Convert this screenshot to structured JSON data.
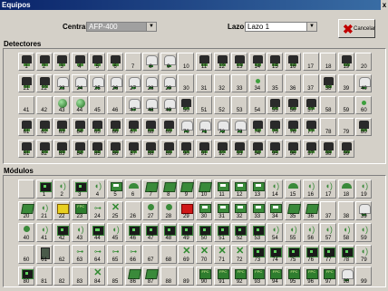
{
  "window": {
    "title": "Equipos",
    "close_glyph": "x"
  },
  "central": {
    "label": "Central",
    "value": "AFP-400"
  },
  "lazo": {
    "label": "Lazo",
    "value": "Lazo 1"
  },
  "cancel_label": "Cancelar",
  "detectores": {
    "title": "Detectores",
    "cells": [
      {
        "n": "1",
        "i": "detector"
      },
      {
        "n": "2",
        "i": "detector"
      },
      {
        "n": "3",
        "i": "detector"
      },
      {
        "n": "4",
        "i": "detector"
      },
      {
        "n": "5",
        "i": "detector"
      },
      {
        "n": "6",
        "i": "detector"
      },
      {
        "n": "7",
        "i": ""
      },
      {
        "n": "8",
        "i": "flat"
      },
      {
        "n": "9",
        "i": "flat"
      },
      {
        "n": "10",
        "i": ""
      },
      {
        "n": "11",
        "i": "detector"
      },
      {
        "n": "12",
        "i": "detector"
      },
      {
        "n": "13",
        "i": "detector"
      },
      {
        "n": "14",
        "i": "detector"
      },
      {
        "n": "15",
        "i": "detector"
      },
      {
        "n": "16",
        "i": "detector"
      },
      {
        "n": "17",
        "i": ""
      },
      {
        "n": "18",
        "i": ""
      },
      {
        "n": "19",
        "i": "detector"
      },
      {
        "n": "20",
        "i": ""
      },
      {
        "n": "21",
        "i": "detector"
      },
      {
        "n": "22",
        "i": "detector"
      },
      {
        "n": "23",
        "i": "flat"
      },
      {
        "n": "24",
        "i": "flat"
      },
      {
        "n": "25",
        "i": "flat"
      },
      {
        "n": "26",
        "i": "flat"
      },
      {
        "n": "27",
        "i": "flat"
      },
      {
        "n": "28",
        "i": "flat"
      },
      {
        "n": "29",
        "i": "flat"
      },
      {
        "n": "30",
        "i": ""
      },
      {
        "n": "31",
        "i": ""
      },
      {
        "n": "32",
        "i": ""
      },
      {
        "n": "33",
        "i": ""
      },
      {
        "n": "34",
        "i": "dot"
      },
      {
        "n": "35",
        "i": ""
      },
      {
        "n": "36",
        "i": ""
      },
      {
        "n": "37",
        "i": ""
      },
      {
        "n": "38",
        "i": "detector"
      },
      {
        "n": "39",
        "i": ""
      },
      {
        "n": "40",
        "i": "flat"
      },
      {
        "n": "41",
        "i": ""
      },
      {
        "n": "42",
        "i": ""
      },
      {
        "n": "43",
        "i": "ball"
      },
      {
        "n": "44",
        "i": "ball"
      },
      {
        "n": "45",
        "i": ""
      },
      {
        "n": "46",
        "i": ""
      },
      {
        "n": "47",
        "i": "flat"
      },
      {
        "n": "48",
        "i": "flat"
      },
      {
        "n": "49",
        "i": "flat"
      },
      {
        "n": "50",
        "i": "detector"
      },
      {
        "n": "51",
        "i": ""
      },
      {
        "n": "52",
        "i": ""
      },
      {
        "n": "53",
        "i": ""
      },
      {
        "n": "54",
        "i": ""
      },
      {
        "n": "55",
        "i": "detector"
      },
      {
        "n": "56",
        "i": "detector"
      },
      {
        "n": "57",
        "i": "detector"
      },
      {
        "n": "58",
        "i": ""
      },
      {
        "n": "59",
        "i": ""
      },
      {
        "n": "60",
        "i": "dot"
      },
      {
        "n": "61",
        "i": "detector"
      },
      {
        "n": "62",
        "i": "detector"
      },
      {
        "n": "63",
        "i": "detector"
      },
      {
        "n": "64",
        "i": "detector"
      },
      {
        "n": "65",
        "i": "detector"
      },
      {
        "n": "66",
        "i": "detector"
      },
      {
        "n": "67",
        "i": "detector"
      },
      {
        "n": "68",
        "i": "detector"
      },
      {
        "n": "69",
        "i": "detector"
      },
      {
        "n": "70",
        "i": "flat"
      },
      {
        "n": "71",
        "i": "flat"
      },
      {
        "n": "72",
        "i": "flat"
      },
      {
        "n": "73",
        "i": "flat"
      },
      {
        "n": "74",
        "i": "detector"
      },
      {
        "n": "75",
        "i": "detector"
      },
      {
        "n": "76",
        "i": "detector"
      },
      {
        "n": "77",
        "i": "detector"
      },
      {
        "n": "78",
        "i": ""
      },
      {
        "n": "79",
        "i": ""
      },
      {
        "n": "80",
        "i": "detector"
      },
      {
        "n": "81",
        "i": "detector"
      },
      {
        "n": "82",
        "i": "detector"
      },
      {
        "n": "83",
        "i": "detector"
      },
      {
        "n": "84",
        "i": "detector"
      },
      {
        "n": "85",
        "i": "detector"
      },
      {
        "n": "86",
        "i": "detector"
      },
      {
        "n": "87",
        "i": "detector"
      },
      {
        "n": "88",
        "i": "detector"
      },
      {
        "n": "89",
        "i": "detector"
      },
      {
        "n": "90",
        "i": "detector"
      },
      {
        "n": "91",
        "i": "detector"
      },
      {
        "n": "92",
        "i": "detector"
      },
      {
        "n": "93",
        "i": "detector"
      },
      {
        "n": "94",
        "i": "detector"
      },
      {
        "n": "95",
        "i": "detector"
      },
      {
        "n": "96",
        "i": "detector"
      },
      {
        "n": "97",
        "i": "detector"
      },
      {
        "n": "98",
        "i": "detector"
      },
      {
        "n": "99",
        "i": "detector"
      }
    ]
  },
  "modulos": {
    "title": "Módulos",
    "cells": [
      {
        "n": "",
        "i": ""
      },
      {
        "n": "1",
        "i": "mod"
      },
      {
        "n": "2",
        "i": "spk"
      },
      {
        "n": "3",
        "i": "mod"
      },
      {
        "n": "4",
        "i": "spk"
      },
      {
        "n": "5",
        "i": "multi"
      },
      {
        "n": "6",
        "i": "bell"
      },
      {
        "n": "7",
        "i": "card"
      },
      {
        "n": "8",
        "i": "card"
      },
      {
        "n": "9",
        "i": "card"
      },
      {
        "n": "10",
        "i": "card"
      },
      {
        "n": "11",
        "i": "multi"
      },
      {
        "n": "12",
        "i": "multi"
      },
      {
        "n": "13",
        "i": "multi"
      },
      {
        "n": "14",
        "i": "spk"
      },
      {
        "n": "15",
        "i": "bell"
      },
      {
        "n": "16",
        "i": "spk"
      },
      {
        "n": "17",
        "i": "spk"
      },
      {
        "n": "18",
        "i": "bell"
      },
      {
        "n": "19",
        "i": "spk"
      },
      {
        "n": "20",
        "i": "card"
      },
      {
        "n": "21",
        "i": "spk"
      },
      {
        "n": "22",
        "i": "yel"
      },
      {
        "n": "23",
        "i": "pcb"
      },
      {
        "n": "24",
        "i": "key"
      },
      {
        "n": "25",
        "i": "cross"
      },
      {
        "n": "26",
        "i": ""
      },
      {
        "n": "27",
        "i": "bulb"
      },
      {
        "n": "28",
        "i": "bulb"
      },
      {
        "n": "29",
        "i": "red"
      },
      {
        "n": "30",
        "i": "multi"
      },
      {
        "n": "31",
        "i": "multi"
      },
      {
        "n": "32",
        "i": "multi"
      },
      {
        "n": "33",
        "i": "multi"
      },
      {
        "n": "34",
        "i": "multi"
      },
      {
        "n": "35",
        "i": "card"
      },
      {
        "n": "36",
        "i": "card"
      },
      {
        "n": "37",
        "i": ""
      },
      {
        "n": "38",
        "i": ""
      },
      {
        "n": "39",
        "i": "flat"
      },
      {
        "n": "40",
        "i": "bulb"
      },
      {
        "n": "41",
        "i": "spk"
      },
      {
        "n": "42",
        "i": "mod"
      },
      {
        "n": "43",
        "i": "spk"
      },
      {
        "n": "44",
        "i": "relay"
      },
      {
        "n": "45",
        "i": "spk"
      },
      {
        "n": "46",
        "i": "mod"
      },
      {
        "n": "47",
        "i": "mod"
      },
      {
        "n": "48",
        "i": "mod"
      },
      {
        "n": "49",
        "i": "mod"
      },
      {
        "n": "50",
        "i": "mod"
      },
      {
        "n": "51",
        "i": "mod"
      },
      {
        "n": "52",
        "i": "mod"
      },
      {
        "n": "53",
        "i": "mod"
      },
      {
        "n": "54",
        "i": "spk"
      },
      {
        "n": "55",
        "i": "spk"
      },
      {
        "n": "56",
        "i": "spk"
      },
      {
        "n": "57",
        "i": "spk"
      },
      {
        "n": "58",
        "i": "spk"
      },
      {
        "n": "59",
        "i": "spk"
      },
      {
        "n": "60",
        "i": ""
      },
      {
        "n": "61",
        "i": "door"
      },
      {
        "n": "62",
        "i": ""
      },
      {
        "n": "63",
        "i": "key"
      },
      {
        "n": "64",
        "i": "key"
      },
      {
        "n": "65",
        "i": "key"
      },
      {
        "n": "66",
        "i": "key"
      },
      {
        "n": "67",
        "i": ""
      },
      {
        "n": "68",
        "i": ""
      },
      {
        "n": "69",
        "i": "cross"
      },
      {
        "n": "70",
        "i": "cross"
      },
      {
        "n": "71",
        "i": "cross"
      },
      {
        "n": "72",
        "i": "cross"
      },
      {
        "n": "73",
        "i": "mod"
      },
      {
        "n": "74",
        "i": "mod"
      },
      {
        "n": "75",
        "i": "mod"
      },
      {
        "n": "76",
        "i": "mod"
      },
      {
        "n": "77",
        "i": "mod"
      },
      {
        "n": "78",
        "i": "mod"
      },
      {
        "n": "79",
        "i": "spk"
      },
      {
        "n": "80",
        "i": "mod"
      },
      {
        "n": "81",
        "i": ""
      },
      {
        "n": "82",
        "i": ""
      },
      {
        "n": "83",
        "i": ""
      },
      {
        "n": "84",
        "i": "cross"
      },
      {
        "n": "85",
        "i": ""
      },
      {
        "n": "86",
        "i": "card"
      },
      {
        "n": "87",
        "i": "card"
      },
      {
        "n": "88",
        "i": ""
      },
      {
        "n": "89",
        "i": ""
      },
      {
        "n": "90",
        "i": "pcb"
      },
      {
        "n": "91",
        "i": "pcb"
      },
      {
        "n": "92",
        "i": "pcb"
      },
      {
        "n": "93",
        "i": "pcb"
      },
      {
        "n": "94",
        "i": "pcb"
      },
      {
        "n": "95",
        "i": "pcb"
      },
      {
        "n": "96",
        "i": "pcb"
      },
      {
        "n": "97",
        "i": "pcb"
      },
      {
        "n": "98",
        "i": "flat"
      },
      {
        "n": "99",
        "i": ""
      }
    ]
  }
}
